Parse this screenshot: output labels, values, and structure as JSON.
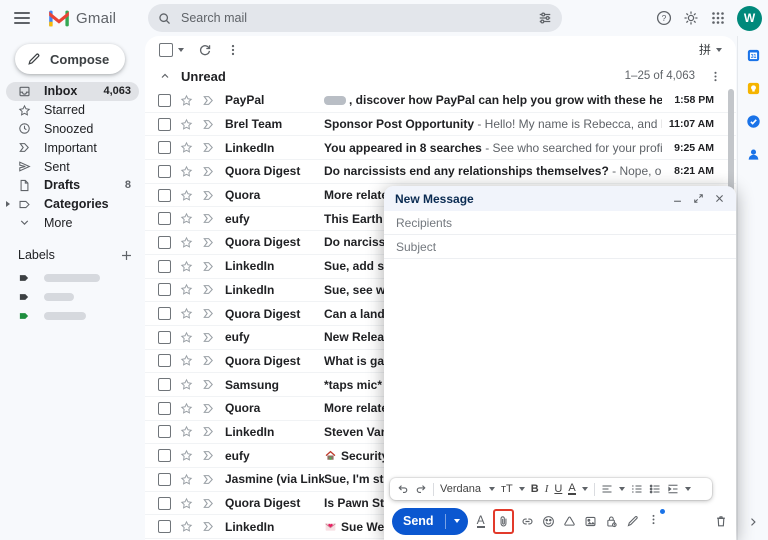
{
  "topbar": {
    "app_name": "Gmail",
    "search_placeholder": "Search mail",
    "avatar_initial": "W"
  },
  "sidebar": {
    "compose_label": "Compose",
    "items": [
      {
        "label": "Inbox",
        "count": "4,063",
        "icon": "inbox-icon",
        "selected": true
      },
      {
        "label": "Starred",
        "count": "",
        "icon": "star-icon"
      },
      {
        "label": "Snoozed",
        "count": "",
        "icon": "clock-icon"
      },
      {
        "label": "Important",
        "count": "",
        "icon": "important-icon"
      },
      {
        "label": "Sent",
        "count": "",
        "icon": "send-icon"
      },
      {
        "label": "Drafts",
        "count": "8",
        "icon": "draft-icon",
        "bold": true
      },
      {
        "label": "Categories",
        "count": "",
        "icon": "tag-icon",
        "bold": true,
        "expander": true
      },
      {
        "label": "More",
        "count": "",
        "icon": "chevron-down-icon"
      }
    ],
    "labels_header": "Labels",
    "labels": [
      {
        "color": "#3c4043",
        "redacted_width": 56
      },
      {
        "color": "#3c4043",
        "redacted_width": 30
      },
      {
        "color": "#1e8e3e",
        "redacted_width": 42
      }
    ]
  },
  "list": {
    "input_tools_label": "拼",
    "section_title": "Unread",
    "pagination": "1–25 of 4,063",
    "rows": [
      {
        "sender": "PayPal",
        "blur_prefix": true,
        "subject": ", discover how PayPal can help you grow with these helpful tip...",
        "snippet": "",
        "time": "1:58 PM"
      },
      {
        "sender": "Brel Team",
        "subject": "Sponsor Post Opportunity",
        "snippet": " - Hello! My name is Rebecca, and I am cont...",
        "time": "11:07 AM"
      },
      {
        "sender": "LinkedIn",
        "subject": "You appeared in 8 searches",
        "snippet": " - See who searched for your profile",
        "trailing": "...",
        "time": "9:25 AM"
      },
      {
        "sender": "Quora Digest",
        "subject": "Do narcissists end any relationships themselves?",
        "snippet": " - Nope, once the n...",
        "time": "8:21 AM"
      },
      {
        "sender": "Quora",
        "subject": "More relate",
        "snippet": "",
        "time": ""
      },
      {
        "sender": "eufy",
        "subject": "This Earth D",
        "snippet": "",
        "time": ""
      },
      {
        "sender": "Quora Digest",
        "subject": "Do narcissis",
        "snippet": "",
        "time": ""
      },
      {
        "sender": "LinkedIn",
        "subject": "Sue, add sa",
        "snippet": "",
        "time": ""
      },
      {
        "sender": "LinkedIn",
        "subject": "Sue, see wh",
        "snippet": "",
        "time": ""
      },
      {
        "sender": "Quora Digest",
        "subject": "Can a landlo",
        "snippet": "",
        "time": ""
      },
      {
        "sender": "eufy",
        "subject": "New Releas",
        "snippet": "",
        "time": ""
      },
      {
        "sender": "Quora Digest",
        "subject": "What is gas",
        "snippet": "",
        "time": ""
      },
      {
        "sender": "Samsung",
        "subject": "*taps mic* A",
        "snippet": "",
        "time": ""
      },
      {
        "sender": "Quora",
        "subject": "More relate",
        "snippet": "",
        "time": ""
      },
      {
        "sender": "LinkedIn",
        "subject": "Steven Van",
        "snippet": "",
        "time": ""
      },
      {
        "sender": "eufy",
        "icon": "house-icon",
        "subject": "Security",
        "snippet": "",
        "time": ""
      },
      {
        "sender": "Jasmine (via Link...",
        "subject": "Sue, I'm stil",
        "snippet": "",
        "time": ""
      },
      {
        "sender": "Quora Digest",
        "subject": "Is Pawn Sta",
        "snippet": "",
        "time": ""
      },
      {
        "sender": "LinkedIn",
        "icon": "love-letter-icon",
        "subject": "Sue Wen",
        "snippet": "",
        "time": ""
      }
    ]
  },
  "right_rail": {
    "apps": [
      "calendar-icon",
      "keep-icon",
      "tasks-icon",
      "contacts-icon"
    ]
  },
  "compose": {
    "title": "New Message",
    "recipients_placeholder": "Recipients",
    "subject_placeholder": "Subject",
    "send_label": "Send",
    "format": {
      "font": "Verdana",
      "size_label": "тT",
      "bold": "B",
      "italic": "I",
      "underline": "U",
      "text_color": "A",
      "formatting_options": "A"
    },
    "highlight_color": "#e23a2b",
    "actions": [
      "formatting-options",
      "attach-file",
      "insert-link",
      "insert-emoji",
      "insert-drive",
      "insert-photo",
      "confidential-mode",
      "insert-signature",
      "more-options",
      "discard-draft"
    ]
  }
}
